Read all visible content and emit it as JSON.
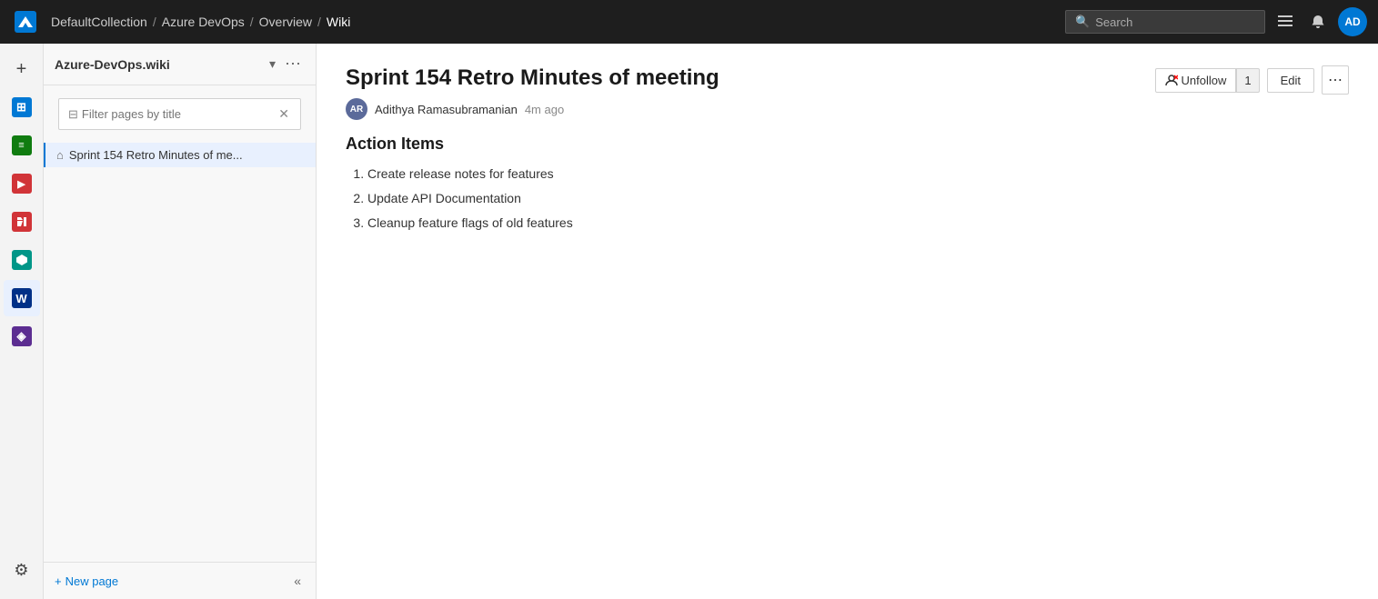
{
  "topNav": {
    "breadcrumbs": [
      {
        "label": "DefaultCollection",
        "href": "#"
      },
      {
        "label": "Azure DevOps",
        "href": "#"
      },
      {
        "label": "Overview",
        "href": "#"
      },
      {
        "label": "Wiki",
        "href": "#"
      }
    ],
    "search": {
      "placeholder": "Search",
      "text": "Search"
    },
    "avatar": {
      "initials": "AD"
    }
  },
  "sidebar": {
    "wikiTitle": "Azure-DevOps.wiki",
    "filterPlaceholder": "Filter pages by title",
    "pages": [
      {
        "label": "Sprint 154 Retro Minutes of me...",
        "isHome": true,
        "active": true
      }
    ],
    "newPageLabel": "New page"
  },
  "content": {
    "title": "Sprint 154 Retro Minutes of meeting",
    "author": {
      "initials": "AR",
      "name": "Adithya Ramasubramanian",
      "timeAgo": "4m ago"
    },
    "actions": {
      "unfollowLabel": "Unfollow",
      "followersCount": "1",
      "editLabel": "Edit"
    },
    "sections": [
      {
        "heading": "Action Items",
        "items": [
          "Create release notes for features",
          "Update API Documentation",
          "Cleanup feature flags of old features"
        ]
      }
    ]
  },
  "navIcons": [
    {
      "name": "add",
      "symbol": "+",
      "tooltip": "Add",
      "boxClass": ""
    },
    {
      "name": "boards",
      "symbol": "⊞",
      "tooltip": "Boards",
      "boxClass": "box-blue"
    },
    {
      "name": "repos",
      "symbol": "≡",
      "tooltip": "Repos",
      "boxClass": "box-green"
    },
    {
      "name": "pipelines",
      "symbol": "▶",
      "tooltip": "Pipelines",
      "boxClass": "box-red"
    },
    {
      "name": "testplans",
      "symbol": "✓",
      "tooltip": "Test Plans",
      "boxClass": "box-red"
    },
    {
      "name": "artifacts",
      "symbol": "⬡",
      "tooltip": "Artifacts",
      "boxClass": "box-teal"
    },
    {
      "name": "wiki",
      "symbol": "W",
      "tooltip": "Wiki",
      "boxClass": "box-darkblue",
      "active": true
    },
    {
      "name": "extensions",
      "symbol": "◈",
      "tooltip": "Extensions",
      "boxClass": "box-purple"
    }
  ]
}
